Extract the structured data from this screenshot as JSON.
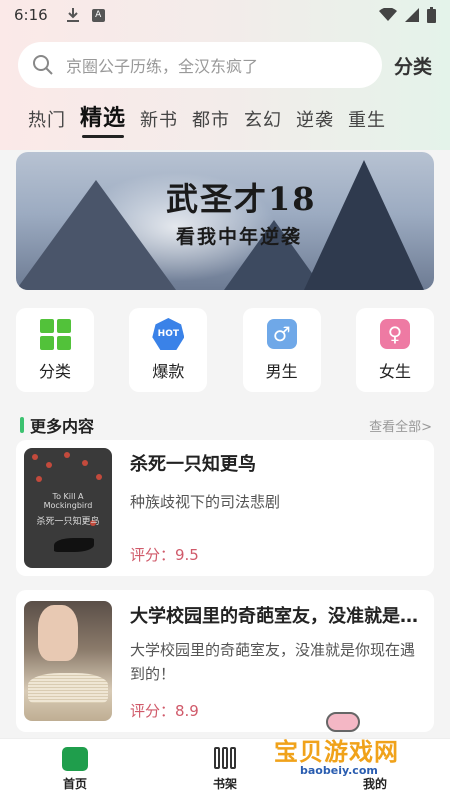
{
  "status_bar": {
    "time": "6:16",
    "download_icon": "download-icon",
    "app_icon": "A"
  },
  "search": {
    "placeholder": "京圈公子历练，全汉东疯了",
    "category_link": "分类"
  },
  "tabs": [
    {
      "label": "热门"
    },
    {
      "label": "精选"
    },
    {
      "label": "新书"
    },
    {
      "label": "都市"
    },
    {
      "label": "玄幻"
    },
    {
      "label": "逆袭"
    },
    {
      "label": "重生"
    }
  ],
  "active_tab": "精选",
  "banner": {
    "title": "武圣才18",
    "subtitle": "看我中年逆袭"
  },
  "categories": [
    {
      "label": "分类",
      "icon": "grid-icon"
    },
    {
      "label": "爆款",
      "icon": "hot-icon",
      "icon_text": "HOT"
    },
    {
      "label": "男生",
      "icon": "male-icon",
      "icon_text": "♂"
    },
    {
      "label": "女生",
      "icon": "female-icon",
      "icon_text": "♀"
    }
  ],
  "section": {
    "title": "更多内容",
    "more": "查看全部>"
  },
  "books": [
    {
      "title": "杀死一只知更鸟",
      "desc": "种族歧视下的司法悲剧",
      "score": "评分：9.5",
      "cover_text": "To Kill A Mockingbird",
      "cover_title": "杀死一只知更鸟"
    },
    {
      "title": "大学校园里的奇葩室友，没准就是你现在遇到的！",
      "desc": "大学校园里的奇葩室友，没准就是你现在遇到的！",
      "score": "评分：8.9"
    }
  ],
  "bottom_nav": [
    {
      "label": "首页",
      "icon": "home-icon"
    },
    {
      "label": "书架",
      "icon": "bookshelf-icon"
    },
    {
      "label": "我的",
      "icon": "profile-icon"
    }
  ],
  "watermark": {
    "text": "宝贝游戏网",
    "url": "baobeiy.com"
  },
  "colors": {
    "accent": "#1f9e4c",
    "score": "#d05a6a",
    "section_bar": "#3cc270"
  }
}
